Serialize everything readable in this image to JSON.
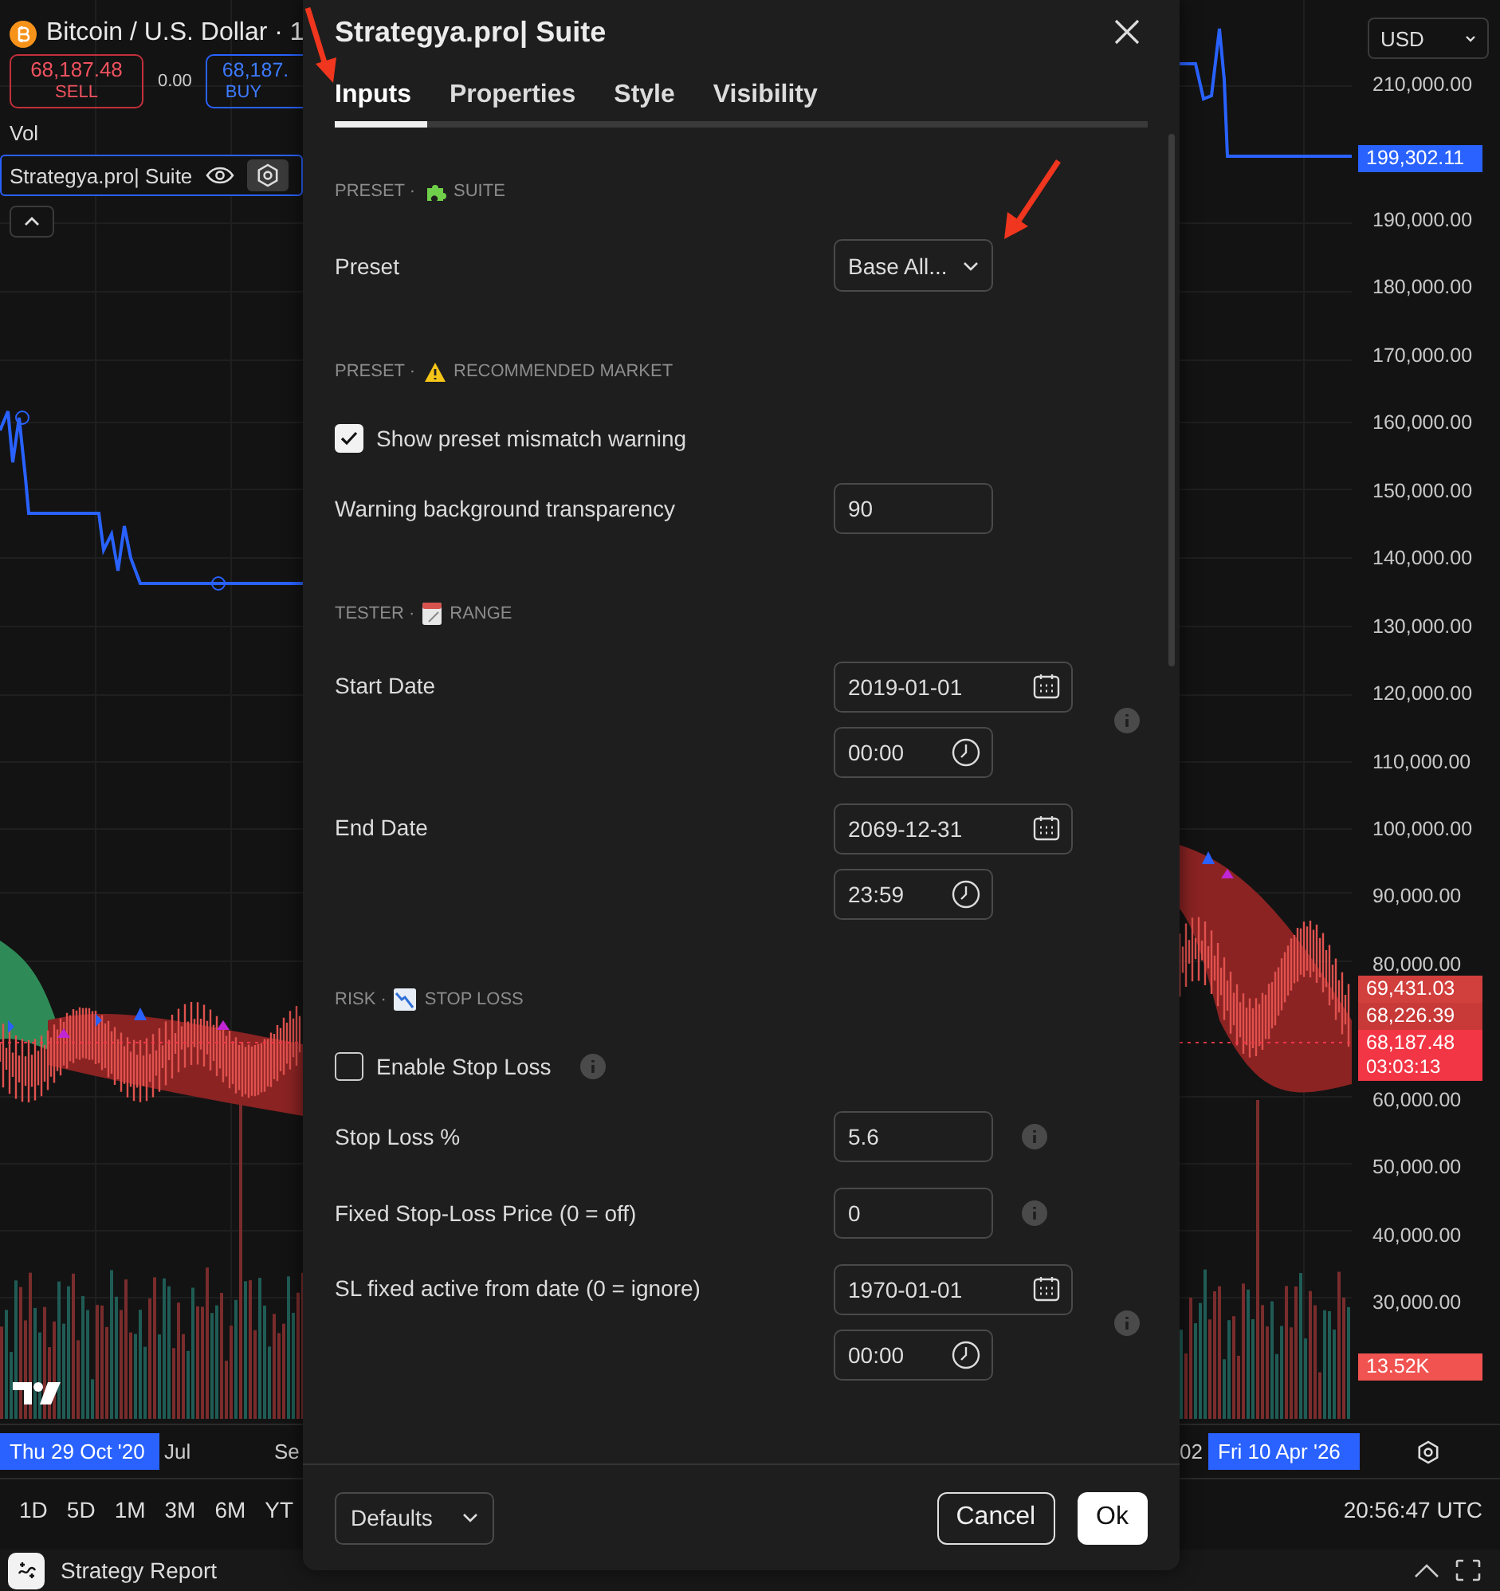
{
  "chart_header": {
    "symbol": "Bitcoin / U.S. Dollar · 1",
    "sell": {
      "price": "68,187.48",
      "label": "SELL"
    },
    "spread": "0.00",
    "buy": {
      "price": "68,187.",
      "label": "BUY"
    },
    "volume_label": "Vol",
    "indicator": "Strategya.pro| Suite"
  },
  "currency": "USD",
  "price_axis": [
    "210,000.00",
    "190,000.00",
    "180,000.00",
    "170,000.00",
    "160,000.00",
    "150,000.00",
    "140,000.00",
    "130,000.00",
    "120,000.00",
    "110,000.00",
    "100,000.00",
    "90,000.00",
    "80,000.00",
    "60,000.00",
    "50,000.00",
    "40,000.00",
    "30,000.00"
  ],
  "price_tags": [
    {
      "text": "199,302.11",
      "color": "#2962ff"
    },
    {
      "text": "69,431.03",
      "color": "#d2403d"
    },
    {
      "text": "68,226.39",
      "color": "#c73a38"
    },
    {
      "text": "68,187.48",
      "subtext": "03:03:13",
      "color": "#f23645"
    },
    {
      "text": "13.52K",
      "color": "#f05350"
    }
  ],
  "time_axis": {
    "start": "Thu 29 Oct '20",
    "labels": [
      "Jul",
      "Se"
    ],
    "right_partial": "02",
    "end": "Fri 10 Apr '26"
  },
  "timeframes": [
    "1D",
    "5D",
    "1M",
    "3M",
    "6M",
    "YT"
  ],
  "clock": "20:56:47 UTC",
  "bottom_panel": {
    "title": "Strategy Report"
  },
  "dialog": {
    "title": "Strategya.pro| Suite",
    "tabs": [
      {
        "label": "Inputs",
        "selected": true
      },
      {
        "label": "Properties",
        "selected": false
      },
      {
        "label": "Style",
        "selected": false
      },
      {
        "label": "Visibility",
        "selected": false
      }
    ],
    "sections": [
      {
        "prefix": "PRESET ·",
        "title": "SUITE",
        "rows": [
          {
            "kind": "select",
            "label": "Preset",
            "value": "Base All..."
          }
        ]
      },
      {
        "prefix": "PRESET ·",
        "title": "RECOMMENDED MARKET",
        "rows": [
          {
            "kind": "checkbox",
            "label": "Show preset mismatch warning",
            "checked": true,
            "info": false
          },
          {
            "kind": "number",
            "label": "Warning background transparency",
            "value": "90",
            "info": false
          }
        ]
      },
      {
        "prefix": "TESTER ·",
        "title": "RANGE",
        "rows": [
          {
            "kind": "datetime",
            "label": "Start Date",
            "date": "2019-01-01",
            "time": "00:00",
            "info": true
          },
          {
            "kind": "datetime",
            "label": "End Date",
            "date": "2069-12-31",
            "time": "23:59",
            "info": false
          }
        ]
      },
      {
        "prefix": "RISK ·",
        "title": "STOP LOSS",
        "rows": [
          {
            "kind": "checkbox",
            "label": "Enable Stop Loss",
            "checked": false,
            "info": true
          },
          {
            "kind": "number",
            "label": "Stop Loss %",
            "value": "5.6",
            "info": true
          },
          {
            "kind": "number",
            "label": "Fixed Stop-Loss Price (0 = off)",
            "value": "0",
            "info": true
          },
          {
            "kind": "datetime",
            "label": "SL fixed active from date (0 = ignore)",
            "date": "1970-01-01",
            "time": "00:00",
            "info": true
          }
        ]
      }
    ],
    "footer": {
      "defaults": "Defaults",
      "cancel": "Cancel",
      "ok": "Ok"
    }
  }
}
